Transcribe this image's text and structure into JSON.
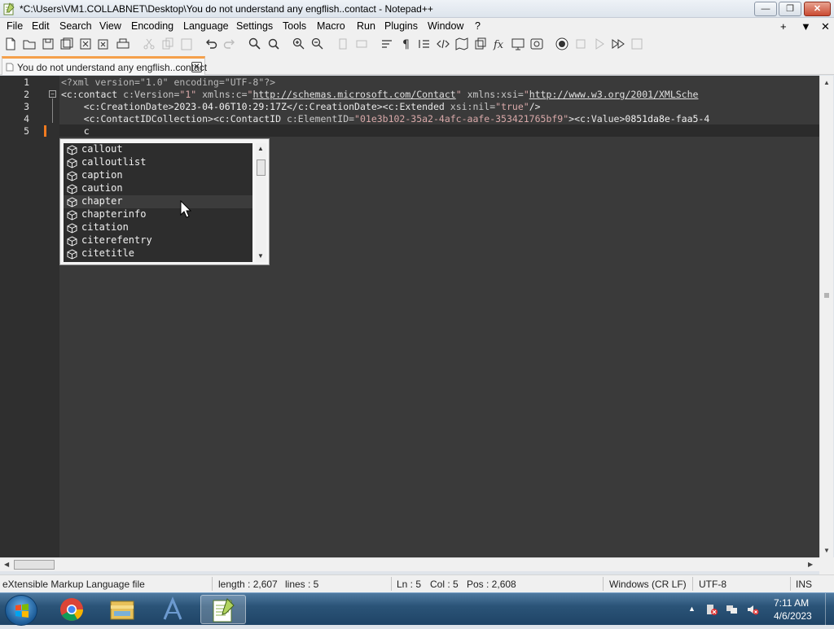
{
  "window": {
    "title": "*C:\\Users\\VM1.COLLABNET\\Desktop\\You do not understand any engflish..contact - Notepad++"
  },
  "menu": {
    "items": [
      "File",
      "Edit",
      "Search",
      "View",
      "Encoding",
      "Language",
      "Settings",
      "Tools",
      "Macro",
      "Run",
      "Plugins",
      "Window",
      "?"
    ],
    "right": [
      "+",
      "▼",
      "✕"
    ]
  },
  "tab": {
    "label": "You do not understand any engflish..contact",
    "close": "✕"
  },
  "editor": {
    "line_numbers": [
      "1",
      "2",
      "3",
      "4",
      "5"
    ],
    "lines": [
      [
        {
          "c": "s-pi",
          "t": "<?xml version=\"1.0\" encoding=\"UTF-8\"?>"
        }
      ],
      [
        {
          "c": "s-tag",
          "t": "<c:contact "
        },
        {
          "c": "s-attr",
          "t": "c:Version="
        },
        {
          "c": "s-str",
          "t": "\"1\""
        },
        {
          "c": "s-attr",
          "t": " xmlns:c="
        },
        {
          "c": "s-str",
          "t": "\""
        },
        {
          "c": "s-url",
          "t": "http://schemas.microsoft.com/Contact"
        },
        {
          "c": "s-str",
          "t": "\""
        },
        {
          "c": "s-attr",
          "t": " xmlns:xsi="
        },
        {
          "c": "s-str",
          "t": "\""
        },
        {
          "c": "s-url",
          "t": "http://www.w3.org/2001/XMLSche"
        }
      ],
      [
        {
          "c": "s-text",
          "t": "    "
        },
        {
          "c": "s-tag",
          "t": "<c:CreationDate>"
        },
        {
          "c": "s-text",
          "t": "2023-04-06T10:29:17Z"
        },
        {
          "c": "s-tag",
          "t": "</c:CreationDate><c:Extended "
        },
        {
          "c": "s-attr",
          "t": "xsi:nil="
        },
        {
          "c": "s-str",
          "t": "\"true\""
        },
        {
          "c": "s-tag",
          "t": "/>"
        }
      ],
      [
        {
          "c": "s-text",
          "t": "    "
        },
        {
          "c": "s-tag",
          "t": "<c:ContactIDCollection><c:ContactID "
        },
        {
          "c": "s-attr",
          "t": "c:ElementID="
        },
        {
          "c": "s-str",
          "t": "\"01e3b102-35a2-4afc-aafe-353421765bf9\""
        },
        {
          "c": "s-tag",
          "t": "><c:Value>"
        },
        {
          "c": "s-text",
          "t": "0851da8e-faa5-4"
        }
      ],
      [
        {
          "c": "s-text",
          "t": "    c"
        }
      ]
    ]
  },
  "autocomplete": {
    "items": [
      "callout",
      "calloutlist",
      "caption",
      "caution",
      "chapter",
      "chapterinfo",
      "citation",
      "citerefentry",
      "citetitle"
    ],
    "hovered": 4
  },
  "status": {
    "file_type": "eXtensible Markup Language file",
    "length": "length : 2,607",
    "lines": "lines : 5",
    "ln": "Ln : 5",
    "col": "Col : 5",
    "pos": "Pos : 2,608",
    "eol": "Windows (CR LF)",
    "encoding": "UTF-8",
    "mode": "INS"
  },
  "taskbar": {
    "time": "7:11 AM",
    "date": "4/6/2023",
    "apps": [
      "chrome-icon",
      "explorer-icon",
      "app-a-icon",
      "notepadpp-icon"
    ]
  },
  "colors": {
    "editor_bg": "#3a3a3a",
    "tab_accent": "#f5a04b",
    "change_marker": "#f07a20"
  }
}
